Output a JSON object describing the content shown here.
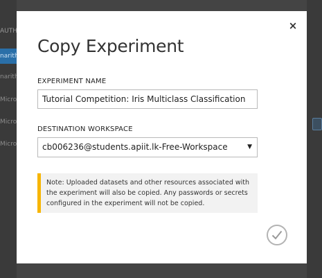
{
  "background": {
    "panel_header": "AUTH",
    "panel_items": [
      "narith",
      "narith",
      "Micro",
      "Micro",
      "Micro"
    ]
  },
  "dialog": {
    "title": "Copy Experiment",
    "close_icon": "×",
    "experiment_name": {
      "label": "EXPERIMENT NAME",
      "value": "Tutorial Competition: Iris Multiclass Classification"
    },
    "destination_workspace": {
      "label": "DESTINATION WORKSPACE",
      "selected": "cb006236@students.apiit.lk-Free-Workspace"
    },
    "note": "Note: Uploaded datasets and other resources associated with the experiment will also be copied. Any passwords or secrets configured in the experiment will not be copied.",
    "ok_icon": "checkmark-icon"
  },
  "colors": {
    "note_accent": "#f7b500",
    "selected_item": "#2a6fa8"
  }
}
